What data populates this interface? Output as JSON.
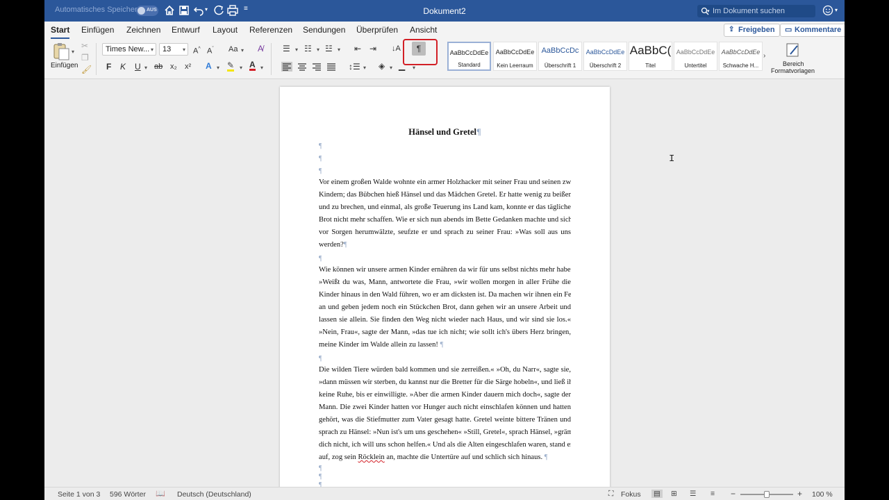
{
  "titlebar": {
    "autosave_label": "Automatisches Speichern",
    "autosave_state": "AUS",
    "document_title": "Dokument2",
    "search_placeholder": "Im Dokument suchen"
  },
  "tabs": [
    {
      "label": "Start",
      "active": true
    },
    {
      "label": "Einfügen"
    },
    {
      "label": "Zeichnen"
    },
    {
      "label": "Entwurf"
    },
    {
      "label": "Layout"
    },
    {
      "label": "Referenzen"
    },
    {
      "label": "Sendungen"
    },
    {
      "label": "Überprüfen"
    },
    {
      "label": "Ansicht"
    }
  ],
  "share": {
    "freigeben": "Freigeben",
    "kommentare": "Kommentare"
  },
  "ribbon": {
    "paste_label": "Einfügen",
    "font_name": "Times New...",
    "font_size": "13",
    "bold": "F",
    "italic": "K",
    "underline": "U",
    "strike": "ab",
    "sub": "x₂",
    "sup": "x²",
    "pilcrow": "¶",
    "styles": [
      {
        "sample": "AaBbCcDdEe",
        "name": "Standard",
        "selected": true
      },
      {
        "sample": "AaBbCcDdEe",
        "name": "Kein Leerraum"
      },
      {
        "sample": "AaBbCcDc",
        "name": "Überschrift 1"
      },
      {
        "sample": "AaBbCcDdEe",
        "name": "Überschrift 2"
      },
      {
        "sample": "AaBbC(",
        "name": "Titel"
      },
      {
        "sample": "AaBbCcDdEe",
        "name": "Untertitel"
      },
      {
        "sample": "AaBbCcDdEe",
        "name": "Schwache H..."
      }
    ],
    "styles_pane_line1": "Bereich",
    "styles_pane_line2": "Formatvorlagen"
  },
  "document": {
    "title": "Hänsel und Gretel",
    "pilcrow": "¶",
    "p1": [
      "Vor einem großen Walde wohnte ein armer Holzhacker mit seiner Frau und seinen zwei",
      "Kindern; das Bübchen hieß Hänsel und das Mädchen Gretel. Er hatte wenig zu beißen",
      "und zu brechen, und einmal, als große Teuerung ins Land kam, konnte er das tägliche",
      "Brot nicht mehr schaffen. Wie er sich nun abends im Bette Gedanken machte und sich",
      "vor Sorgen herumwälzte, seufzte er und sprach zu seiner Frau: »Was soll aus uns",
      "werden?"
    ],
    "p2": [
      "Wie können wir unsere armen Kinder ernähren da wir für uns selbst nichts mehr haben?«",
      "»Weißt du was, Mann, antwortete die Frau, »wir wollen morgen in aller Frühe die",
      "Kinder hinaus in den Wald führen, wo er am dicksten ist. Da machen wir ihnen ein Feuer",
      "an und geben jedem noch ein Stückchen Brot, dann gehen wir an unsere Arbeit und",
      "lassen sie allein. Sie finden den Weg nicht wieder nach Haus, und wir sind sie los.«",
      "»Nein, Frau«, sagte der Mann, »das tue ich nicht; wie sollt ich's übers Herz bringen,",
      "meine Kinder im Walde allein zu lassen!"
    ],
    "p3": [
      "Die wilden Tiere würden bald kommen und sie zerreißen.« »Oh, du Narr«, sagte sie,",
      "»dann müssen wir sterben, du kannst nur die Bretter für die Särge hobeln«, und ließ ihm",
      "keine Ruhe, bis er einwilligte. »Aber die armen Kinder dauern mich doch«, sagte der",
      "Mann. Die zwei Kinder hatten vor Hunger auch nicht einschlafen können und hatten",
      "gehört, was die Stiefmutter zum Vater gesagt hatte. Gretel weinte bittere Tränen und",
      "sprach zu Hänsel: »Nun ist's um uns geschehen« »Still, Gretel«, sprach Hänsel, »gräme",
      "dich nicht, ich will uns schon helfen.« Und als die Alten eingeschlafen waren, stand er"
    ],
    "p3_last_before": "auf, zog sein ",
    "p3_last_misspelled": "Röcklein",
    "p3_last_after": " an, machte die Untertüre auf und schlich sich hinaus."
  },
  "statusbar": {
    "page": "Seite 1 von 3",
    "words": "596 Wörter",
    "language": "Deutsch (Deutschland)",
    "focus": "Fokus",
    "zoom": "100 %"
  },
  "colors": {
    "accent": "#2b579a",
    "highlight_box": "#d21f26"
  },
  "zoom_level_fraction": 0.5
}
